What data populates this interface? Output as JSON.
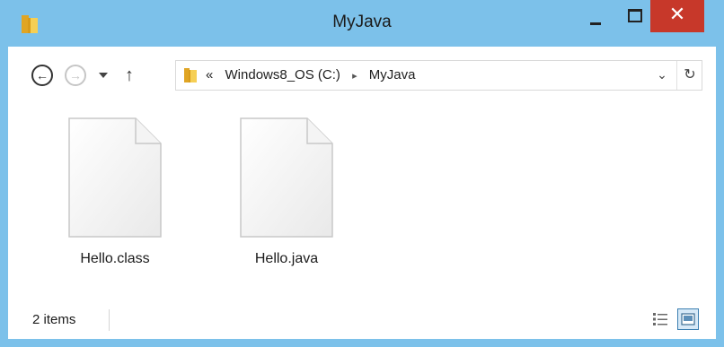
{
  "window": {
    "title": "MyJava",
    "controls": {
      "minimize": "minimize",
      "maximize": "maximize",
      "close": "✕"
    }
  },
  "nav": {
    "back_icon": "←",
    "forward_icon": "→",
    "up_icon": "↑",
    "breadcrumb": {
      "overflow": "«",
      "items": [
        "Windows8_OS (C:)",
        "MyJava"
      ],
      "separator": "▸"
    },
    "dropdown_icon": "⌄",
    "refresh_icon": "↻"
  },
  "files": [
    {
      "name": "Hello.class",
      "icon": "blank-file-icon"
    },
    {
      "name": "Hello.java",
      "icon": "blank-file-icon"
    }
  ],
  "status": {
    "item_count": "2 items"
  },
  "colors": {
    "frame": "#7cc1ea",
    "close_button": "#c7382a",
    "folder": "#e8b83a"
  }
}
